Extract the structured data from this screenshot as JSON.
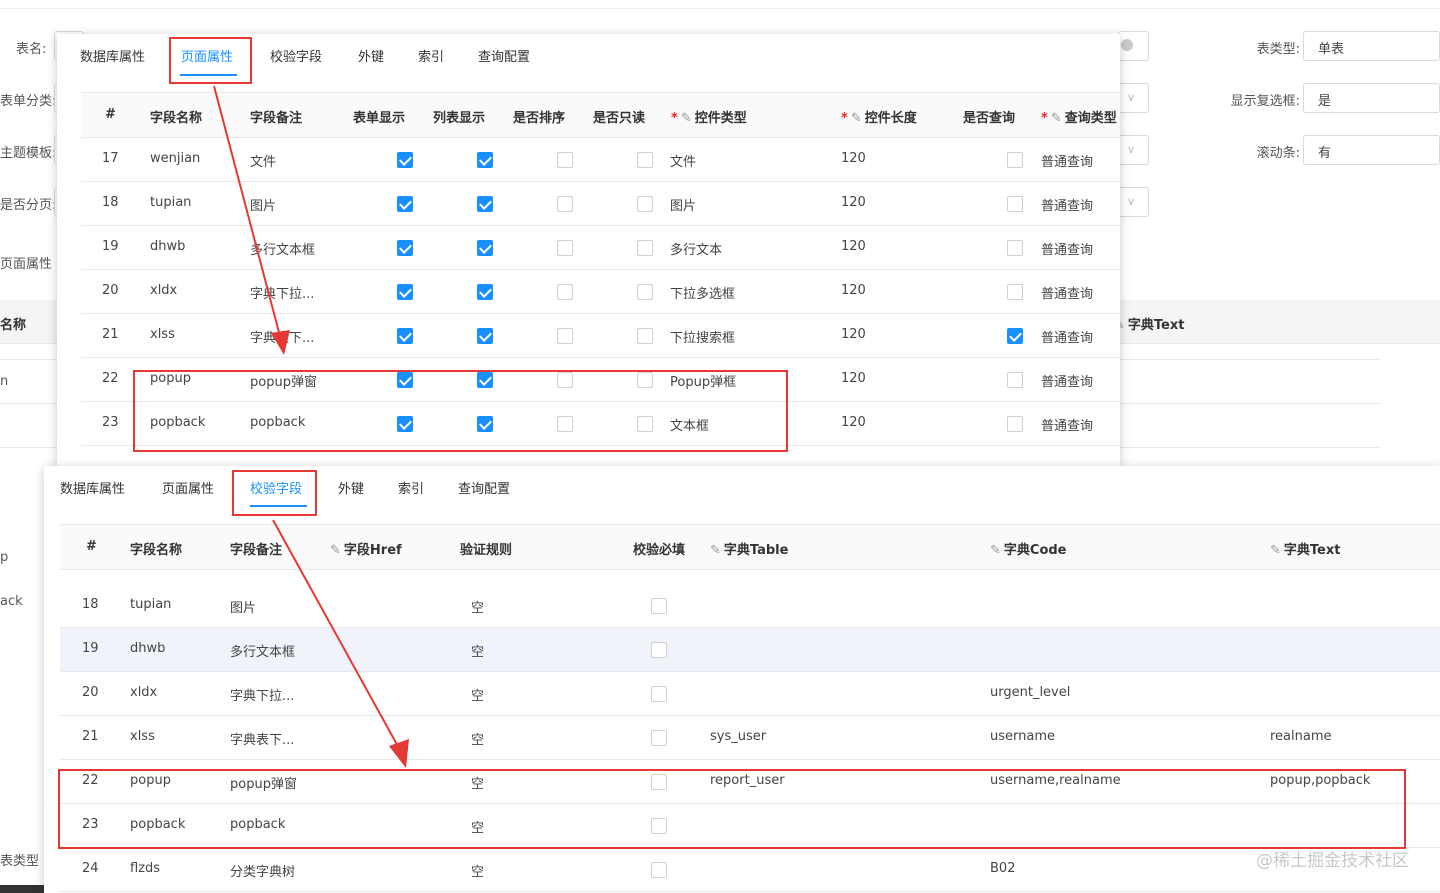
{
  "bg": {
    "labels": [
      "表名:",
      "表单分类:",
      "主题模板:",
      "是否分页:",
      "页面属性"
    ],
    "right_labels": [
      "表类型:",
      "显示复选框:",
      "滚动条:"
    ],
    "right_values": [
      "单表",
      "是",
      "有"
    ],
    "col_name_fragment": "名称",
    "dict_text_header": "字典Text",
    "left_fragments": [
      "n",
      "p",
      "p",
      "ack",
      "表类型"
    ]
  },
  "panel1": {
    "tabs": [
      "数据库属性",
      "页面属性",
      "校验字段",
      "外键",
      "索引",
      "查询配置"
    ],
    "active_tab": 1,
    "headers": [
      "#",
      "字段名称",
      "字段备注",
      "表单显示",
      "列表显示",
      "是否排序",
      "是否只读",
      "控件类型",
      "控件长度",
      "是否查询",
      "查询类型"
    ],
    "rows": [
      {
        "n": "17",
        "name": "wenjian",
        "remark": "文件",
        "form": true,
        "list": true,
        "sort": false,
        "ro": false,
        "ctrl": "文件",
        "len": "120",
        "query": false,
        "qtype": "普通查询"
      },
      {
        "n": "18",
        "name": "tupian",
        "remark": "图片",
        "form": true,
        "list": true,
        "sort": false,
        "ro": false,
        "ctrl": "图片",
        "len": "120",
        "query": false,
        "qtype": "普通查询"
      },
      {
        "n": "19",
        "name": "dhwb",
        "remark": "多行文本框",
        "form": true,
        "list": true,
        "sort": false,
        "ro": false,
        "ctrl": "多行文本",
        "len": "120",
        "query": false,
        "qtype": "普通查询"
      },
      {
        "n": "20",
        "name": "xldx",
        "remark": "字典下拉...",
        "form": true,
        "list": true,
        "sort": false,
        "ro": false,
        "ctrl": "下拉多选框",
        "len": "120",
        "query": false,
        "qtype": "普通查询"
      },
      {
        "n": "21",
        "name": "xlss",
        "remark": "字典表下...",
        "form": true,
        "list": true,
        "sort": false,
        "ro": false,
        "ctrl": "下拉搜索框",
        "len": "120",
        "query": true,
        "qtype": "普通查询"
      },
      {
        "n": "22",
        "name": "popup",
        "remark": "popup弹窗",
        "form": true,
        "list": true,
        "sort": false,
        "ro": false,
        "ctrl": "Popup弹框",
        "len": "120",
        "query": false,
        "qtype": "普通查询"
      },
      {
        "n": "23",
        "name": "popback",
        "remark": "popback",
        "form": true,
        "list": true,
        "sort": false,
        "ro": false,
        "ctrl": "文本框",
        "len": "120",
        "query": false,
        "qtype": "普通查询"
      }
    ]
  },
  "panel2": {
    "tabs": [
      "数据库属性",
      "页面属性",
      "校验字段",
      "外键",
      "索引",
      "查询配置"
    ],
    "active_tab": 2,
    "headers": [
      "#",
      "字段名称",
      "字段备注",
      "字段Href",
      "验证规则",
      "校验必填",
      "字典Table",
      "字典Code",
      "字典Text"
    ],
    "rows": [
      {
        "n": "18",
        "name": "tupian",
        "remark": "图片",
        "rule": "空",
        "table": "",
        "code": "",
        "text": ""
      },
      {
        "n": "19",
        "name": "dhwb",
        "remark": "多行文本框",
        "rule": "空",
        "table": "",
        "code": "",
        "text": ""
      },
      {
        "n": "20",
        "name": "xldx",
        "remark": "字典下拉...",
        "rule": "空",
        "table": "",
        "code": "urgent_level",
        "text": ""
      },
      {
        "n": "21",
        "name": "xlss",
        "remark": "字典表下...",
        "rule": "空",
        "table": "sys_user",
        "code": "username",
        "text": "realname"
      },
      {
        "n": "22",
        "name": "popup",
        "remark": "popup弹窗",
        "rule": "空",
        "table": "report_user",
        "code": "username,realname",
        "text": "popup,popback"
      },
      {
        "n": "23",
        "name": "popback",
        "remark": "popback",
        "rule": "空",
        "table": "",
        "code": "",
        "text": ""
      },
      {
        "n": "24",
        "name": "flzds",
        "remark": "分类字典树",
        "rule": "空",
        "table": "",
        "code": "B02",
        "text": ""
      }
    ]
  },
  "watermark": "@稀土掘金技术社区",
  "colors": {
    "accent": "#1890ff",
    "annotation": "#e53935"
  }
}
